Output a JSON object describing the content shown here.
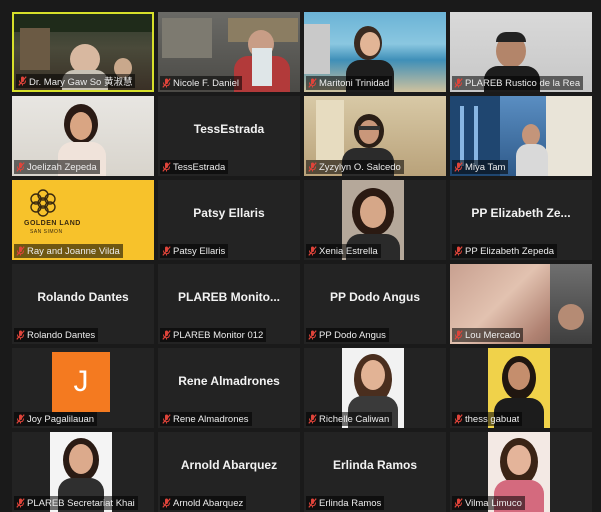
{
  "colors": {
    "background": "#1a1a1a",
    "tile": "#232323",
    "active_speaker_border": "#d7e02a",
    "muted_mic": "#e0443a",
    "avatar_j": "#f47a20"
  },
  "participants": [
    {
      "label": "Dr. Mary Gaw So 黄淑慧",
      "kind": "video",
      "active": true,
      "scene": "room"
    },
    {
      "label": "Nicole F. Daniel",
      "kind": "video",
      "scene": "office"
    },
    {
      "label": "Maritoni Trinidad",
      "kind": "video",
      "scene": "beach"
    },
    {
      "label": "PLAREB Rustico de la Rea",
      "kind": "video",
      "scene": "man"
    },
    {
      "label": "Joelizah Zepeda",
      "kind": "video",
      "scene": "woman-light"
    },
    {
      "label": "TessEstrada",
      "center_name": "TessEstrada",
      "kind": "name"
    },
    {
      "label": "Zyzylyn O. Salcedo",
      "kind": "video",
      "scene": "woman-glasses"
    },
    {
      "label": "Miya Tam",
      "kind": "video",
      "scene": "city"
    },
    {
      "label": "Ray and Joanne Vilda",
      "kind": "logo",
      "logo_line1": "GOLDEN LAND",
      "logo_line2": "SAN SIMON"
    },
    {
      "label": "Patsy Ellaris",
      "center_name": "Patsy Ellaris",
      "kind": "name"
    },
    {
      "label": "Xenia Estrella",
      "kind": "photo",
      "scene": "portrait-brown"
    },
    {
      "label": "PP Elizabeth Zepeda",
      "center_name": "PP Elizabeth Ze...",
      "kind": "name"
    },
    {
      "label": "Rolando Dantes",
      "center_name": "Rolando Dantes",
      "kind": "name"
    },
    {
      "label": "PLAREB Monitor 012",
      "center_name": "PLAREB Monito...",
      "kind": "name"
    },
    {
      "label": "PP Dodo Angus",
      "center_name": "PP Dodo Angus",
      "kind": "name"
    },
    {
      "label": "Lou Mercado",
      "kind": "video",
      "scene": "blur"
    },
    {
      "label": "Joy Pagalilauan",
      "kind": "avatar",
      "avatar_letter": "J"
    },
    {
      "label": "Rene Almadrones",
      "center_name": "Rene Almadrones",
      "kind": "name"
    },
    {
      "label": "Richelle Caliwan",
      "kind": "photo",
      "scene": "portrait-white"
    },
    {
      "label": "thess gabuat",
      "kind": "photo",
      "scene": "portrait-yellow"
    },
    {
      "label": "PLAREB Secretariat Khai",
      "kind": "photo",
      "scene": "portrait-white-2"
    },
    {
      "label": "Arnold Abarquez",
      "center_name": "Arnold Abarquez",
      "kind": "name"
    },
    {
      "label": "Erlinda Ramos",
      "center_name": "Erlinda Ramos",
      "kind": "name"
    },
    {
      "label": "Vilma Limuco",
      "kind": "photo",
      "scene": "portrait-pink"
    }
  ]
}
